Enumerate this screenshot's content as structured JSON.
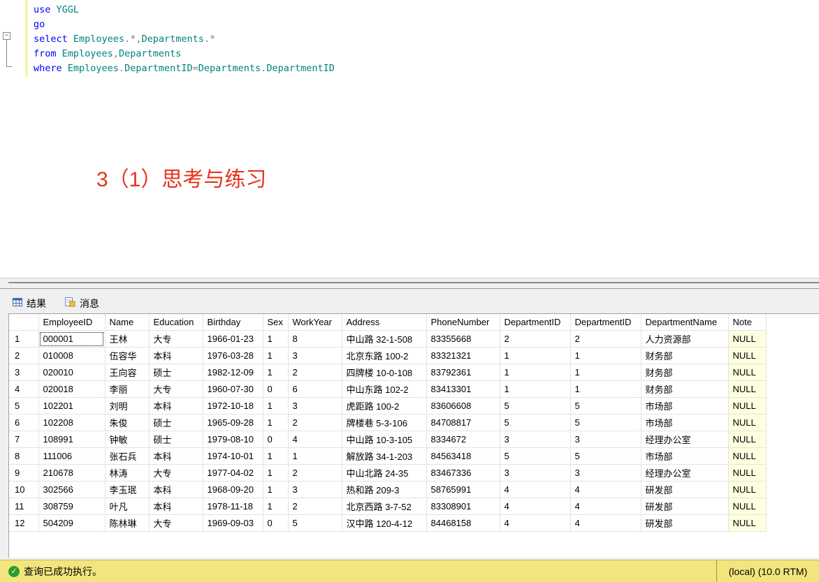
{
  "editor": {
    "lines": [
      {
        "parts": [
          {
            "c": "kw",
            "t": "use "
          },
          {
            "c": "id",
            "t": "YGGL"
          }
        ]
      },
      {
        "parts": [
          {
            "c": "kw",
            "t": "go"
          }
        ]
      },
      {
        "parts": [
          {
            "c": "kw",
            "t": "select "
          },
          {
            "c": "id",
            "t": "Employees"
          },
          {
            "c": "op",
            "t": "."
          },
          {
            "c": "op",
            "t": "*"
          },
          {
            "c": "op",
            "t": ","
          },
          {
            "c": "id",
            "t": "Departments"
          },
          {
            "c": "op",
            "t": "."
          },
          {
            "c": "op",
            "t": "*"
          }
        ]
      },
      {
        "parts": [
          {
            "c": "kw",
            "t": "from "
          },
          {
            "c": "id",
            "t": "Employees"
          },
          {
            "c": "op",
            "t": ","
          },
          {
            "c": "id",
            "t": "Departments"
          }
        ]
      },
      {
        "parts": [
          {
            "c": "kw",
            "t": "where "
          },
          {
            "c": "id",
            "t": "Employees"
          },
          {
            "c": "op",
            "t": "."
          },
          {
            "c": "id",
            "t": "DepartmentID"
          },
          {
            "c": "op",
            "t": "="
          },
          {
            "c": "id",
            "t": "Departments"
          },
          {
            "c": "op",
            "t": "."
          },
          {
            "c": "id",
            "t": "DepartmentID"
          }
        ]
      }
    ],
    "annotation": "3（1）思考与练习"
  },
  "tabs": {
    "results": "结果",
    "messages": "消息"
  },
  "results": {
    "columns": [
      "",
      "EmployeeID",
      "Name",
      "Education",
      "Birthday",
      "Sex",
      "WorkYear",
      "Address",
      "PhoneNumber",
      "DepartmentID",
      "DepartmentID",
      "DepartmentName",
      "Note"
    ],
    "rows": [
      [
        "1",
        "000001",
        "王林",
        "大专",
        "1966-01-23",
        "1",
        "8",
        "中山路 32-1-508",
        "83355668",
        "2",
        "2",
        "人力资源部",
        "NULL"
      ],
      [
        "2",
        "010008",
        "伍容华",
        "本科",
        "1976-03-28",
        "1",
        "3",
        "北京东路 100-2",
        "83321321",
        "1",
        "1",
        "财务部",
        "NULL"
      ],
      [
        "3",
        "020010",
        "王向容",
        "硕士",
        "1982-12-09",
        "1",
        "2",
        "四牌楼 10-0-108",
        "83792361",
        "1",
        "1",
        "财务部",
        "NULL"
      ],
      [
        "4",
        "020018",
        "李丽",
        "大专",
        "1960-07-30",
        "0",
        "6",
        "中山东路 102-2",
        "83413301",
        "1",
        "1",
        "财务部",
        "NULL"
      ],
      [
        "5",
        "102201",
        "刘明",
        "本科",
        "1972-10-18",
        "1",
        "3",
        "虎距路 100-2",
        "83606608",
        "5",
        "5",
        "市场部",
        "NULL"
      ],
      [
        "6",
        "102208",
        "朱俊",
        "硕士",
        "1965-09-28",
        "1",
        "2",
        "牌楼巷 5-3-106",
        "84708817",
        "5",
        "5",
        "市场部",
        "NULL"
      ],
      [
        "7",
        "108991",
        "钟敏",
        "硕士",
        "1979-08-10",
        "0",
        "4",
        "中山路 10-3-105",
        "8334672",
        "3",
        "3",
        "经理办公室",
        "NULL"
      ],
      [
        "8",
        "111006",
        "张石兵",
        "本科",
        "1974-10-01",
        "1",
        "1",
        "解放路 34-1-203",
        "84563418",
        "5",
        "5",
        "市场部",
        "NULL"
      ],
      [
        "9",
        "210678",
        "林涛",
        "大专",
        "1977-04-02",
        "1",
        "2",
        "中山北路 24-35",
        "83467336",
        "3",
        "3",
        "经理办公室",
        "NULL"
      ],
      [
        "10",
        "302566",
        "李玉珉",
        "本科",
        "1968-09-20",
        "1",
        "3",
        "热和路 209-3",
        "58765991",
        "4",
        "4",
        "研发部",
        "NULL"
      ],
      [
        "11",
        "308759",
        "叶凡",
        "本科",
        "1978-11-18",
        "1",
        "2",
        "北京西路 3-7-52",
        "83308901",
        "4",
        "4",
        "研发部",
        "NULL"
      ],
      [
        "12",
        "504209",
        "陈林琳",
        "大专",
        "1969-09-03",
        "0",
        "5",
        "汉中路 120-4-12",
        "84468158",
        "4",
        "4",
        "研发部",
        "NULL"
      ]
    ]
  },
  "status": {
    "message": "查询已成功执行。",
    "server": "(local) (10.0 RTM)"
  }
}
